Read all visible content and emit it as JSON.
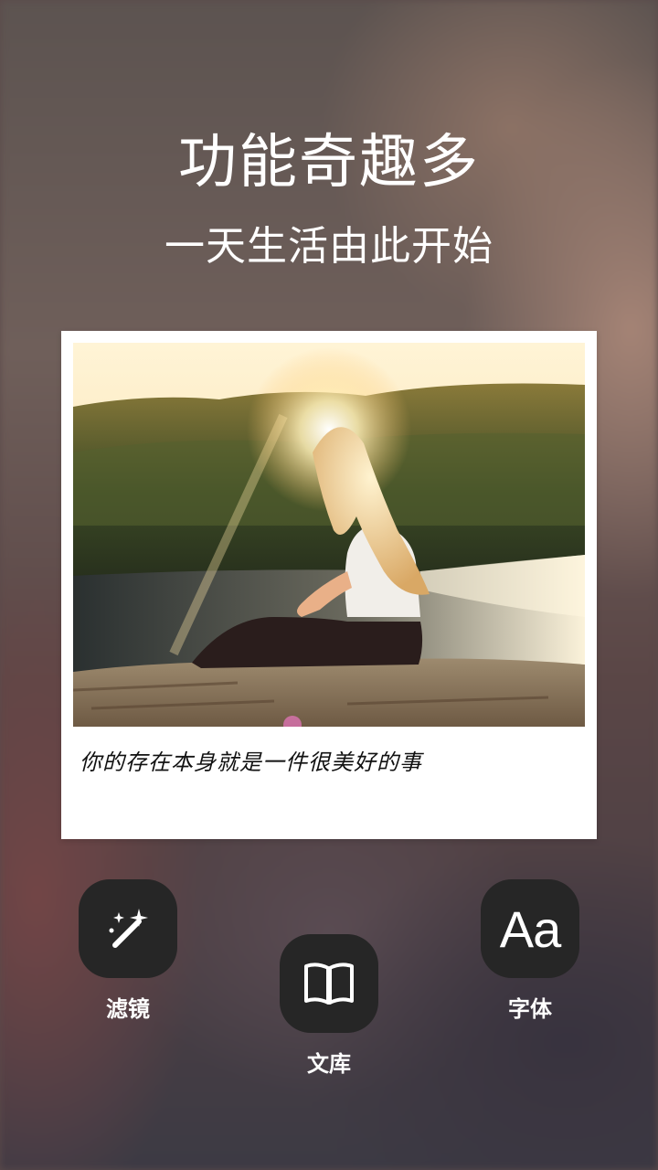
{
  "hero": {
    "title": "功能奇趣多",
    "subtitle": "一天生活由此开始"
  },
  "card": {
    "caption": "你的存在本身就是一件很美好的事"
  },
  "tools": {
    "filter": {
      "label": "滤镜",
      "icon": "magic-wand-icon"
    },
    "library": {
      "label": "文库",
      "icon": "open-book-icon"
    },
    "font": {
      "label": "字体",
      "icon": "font-aa-icon",
      "glyph": "Aa"
    }
  }
}
